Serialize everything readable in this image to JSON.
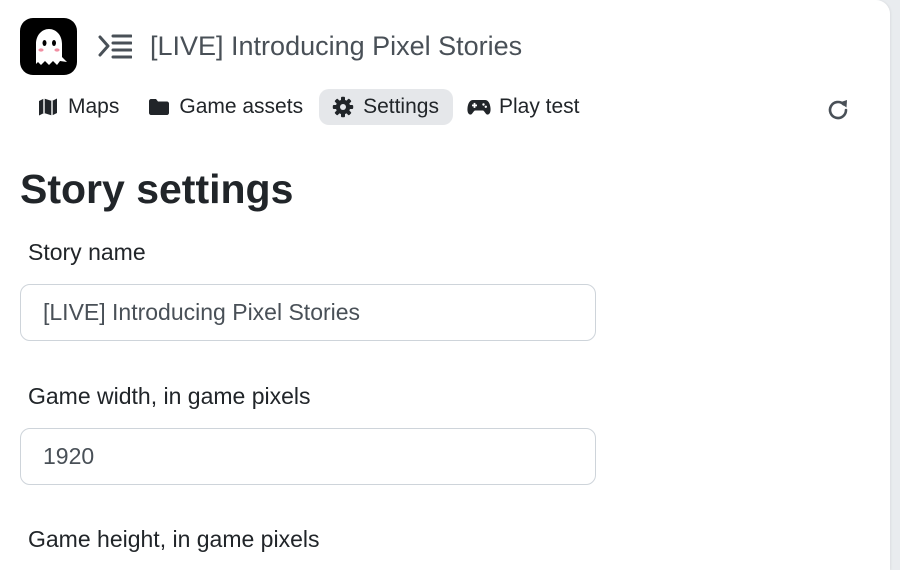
{
  "header": {
    "logo_icon": "ghost-icon",
    "menu_icon": "menu-collapse-icon",
    "title": "[LIVE] Introducing Pixel Stories"
  },
  "nav": {
    "items": [
      {
        "label": "Maps",
        "icon": "map-icon",
        "active": false
      },
      {
        "label": "Game assets",
        "icon": "folder-icon",
        "active": false
      },
      {
        "label": "Settings",
        "icon": "gear-icon",
        "active": true
      },
      {
        "label": "Play test",
        "icon": "gamepad-icon",
        "active": false
      }
    ],
    "refresh_icon": "refresh-icon"
  },
  "main": {
    "title": "Story settings",
    "fields": {
      "story_name": {
        "label": "Story name",
        "value": "[LIVE] Introducing Pixel Stories"
      },
      "game_width": {
        "label": "Game width, in game pixels",
        "value": "1920"
      },
      "game_height": {
        "label": "Game height, in game pixels"
      }
    }
  },
  "colors": {
    "active_tab_bg": "#e5e7ea",
    "text": "#212529",
    "muted_text": "#495057",
    "input_border": "#ced4da"
  }
}
